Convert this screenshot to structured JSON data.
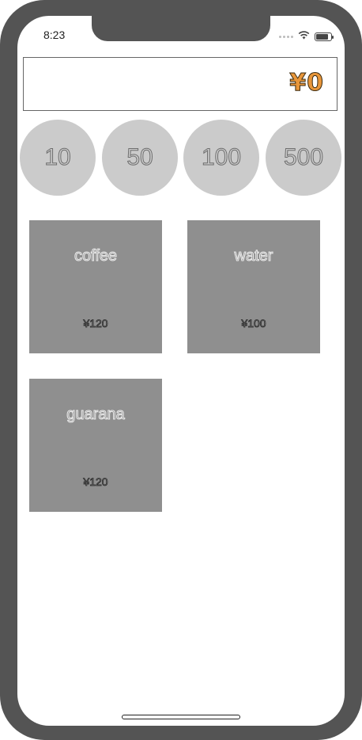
{
  "status_bar": {
    "time": "8:23",
    "wifi_icon": "wifi-icon",
    "battery_icon": "battery-icon",
    "battery_level": 0.85
  },
  "balance": {
    "display": "¥0",
    "color": "#e8963a"
  },
  "coins": [
    {
      "label": "10"
    },
    {
      "label": "50"
    },
    {
      "label": "100"
    },
    {
      "label": "500"
    }
  ],
  "products": [
    {
      "name": "coffee",
      "price": "¥120"
    },
    {
      "name": "water",
      "price": "¥100"
    },
    {
      "name": "guarana",
      "price": "¥120"
    }
  ],
  "colors": {
    "device_frame": "#545454",
    "coin_background": "#cbcbcb",
    "product_background": "#8f8f8f"
  }
}
